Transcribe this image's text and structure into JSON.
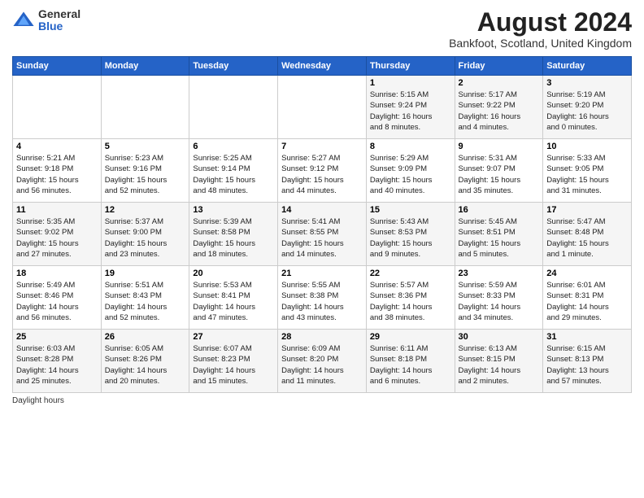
{
  "header": {
    "logo_general": "General",
    "logo_blue": "Blue",
    "title": "August 2024",
    "subtitle": "Bankfoot, Scotland, United Kingdom"
  },
  "weekdays": [
    "Sunday",
    "Monday",
    "Tuesday",
    "Wednesday",
    "Thursday",
    "Friday",
    "Saturday"
  ],
  "weeks": [
    [
      {
        "day": "",
        "detail": ""
      },
      {
        "day": "",
        "detail": ""
      },
      {
        "day": "",
        "detail": ""
      },
      {
        "day": "",
        "detail": ""
      },
      {
        "day": "1",
        "detail": "Sunrise: 5:15 AM\nSunset: 9:24 PM\nDaylight: 16 hours\nand 8 minutes."
      },
      {
        "day": "2",
        "detail": "Sunrise: 5:17 AM\nSunset: 9:22 PM\nDaylight: 16 hours\nand 4 minutes."
      },
      {
        "day": "3",
        "detail": "Sunrise: 5:19 AM\nSunset: 9:20 PM\nDaylight: 16 hours\nand 0 minutes."
      }
    ],
    [
      {
        "day": "4",
        "detail": "Sunrise: 5:21 AM\nSunset: 9:18 PM\nDaylight: 15 hours\nand 56 minutes."
      },
      {
        "day": "5",
        "detail": "Sunrise: 5:23 AM\nSunset: 9:16 PM\nDaylight: 15 hours\nand 52 minutes."
      },
      {
        "day": "6",
        "detail": "Sunrise: 5:25 AM\nSunset: 9:14 PM\nDaylight: 15 hours\nand 48 minutes."
      },
      {
        "day": "7",
        "detail": "Sunrise: 5:27 AM\nSunset: 9:12 PM\nDaylight: 15 hours\nand 44 minutes."
      },
      {
        "day": "8",
        "detail": "Sunrise: 5:29 AM\nSunset: 9:09 PM\nDaylight: 15 hours\nand 40 minutes."
      },
      {
        "day": "9",
        "detail": "Sunrise: 5:31 AM\nSunset: 9:07 PM\nDaylight: 15 hours\nand 35 minutes."
      },
      {
        "day": "10",
        "detail": "Sunrise: 5:33 AM\nSunset: 9:05 PM\nDaylight: 15 hours\nand 31 minutes."
      }
    ],
    [
      {
        "day": "11",
        "detail": "Sunrise: 5:35 AM\nSunset: 9:02 PM\nDaylight: 15 hours\nand 27 minutes."
      },
      {
        "day": "12",
        "detail": "Sunrise: 5:37 AM\nSunset: 9:00 PM\nDaylight: 15 hours\nand 23 minutes."
      },
      {
        "day": "13",
        "detail": "Sunrise: 5:39 AM\nSunset: 8:58 PM\nDaylight: 15 hours\nand 18 minutes."
      },
      {
        "day": "14",
        "detail": "Sunrise: 5:41 AM\nSunset: 8:55 PM\nDaylight: 15 hours\nand 14 minutes."
      },
      {
        "day": "15",
        "detail": "Sunrise: 5:43 AM\nSunset: 8:53 PM\nDaylight: 15 hours\nand 9 minutes."
      },
      {
        "day": "16",
        "detail": "Sunrise: 5:45 AM\nSunset: 8:51 PM\nDaylight: 15 hours\nand 5 minutes."
      },
      {
        "day": "17",
        "detail": "Sunrise: 5:47 AM\nSunset: 8:48 PM\nDaylight: 15 hours\nand 1 minute."
      }
    ],
    [
      {
        "day": "18",
        "detail": "Sunrise: 5:49 AM\nSunset: 8:46 PM\nDaylight: 14 hours\nand 56 minutes."
      },
      {
        "day": "19",
        "detail": "Sunrise: 5:51 AM\nSunset: 8:43 PM\nDaylight: 14 hours\nand 52 minutes."
      },
      {
        "day": "20",
        "detail": "Sunrise: 5:53 AM\nSunset: 8:41 PM\nDaylight: 14 hours\nand 47 minutes."
      },
      {
        "day": "21",
        "detail": "Sunrise: 5:55 AM\nSunset: 8:38 PM\nDaylight: 14 hours\nand 43 minutes."
      },
      {
        "day": "22",
        "detail": "Sunrise: 5:57 AM\nSunset: 8:36 PM\nDaylight: 14 hours\nand 38 minutes."
      },
      {
        "day": "23",
        "detail": "Sunrise: 5:59 AM\nSunset: 8:33 PM\nDaylight: 14 hours\nand 34 minutes."
      },
      {
        "day": "24",
        "detail": "Sunrise: 6:01 AM\nSunset: 8:31 PM\nDaylight: 14 hours\nand 29 minutes."
      }
    ],
    [
      {
        "day": "25",
        "detail": "Sunrise: 6:03 AM\nSunset: 8:28 PM\nDaylight: 14 hours\nand 25 minutes."
      },
      {
        "day": "26",
        "detail": "Sunrise: 6:05 AM\nSunset: 8:26 PM\nDaylight: 14 hours\nand 20 minutes."
      },
      {
        "day": "27",
        "detail": "Sunrise: 6:07 AM\nSunset: 8:23 PM\nDaylight: 14 hours\nand 15 minutes."
      },
      {
        "day": "28",
        "detail": "Sunrise: 6:09 AM\nSunset: 8:20 PM\nDaylight: 14 hours\nand 11 minutes."
      },
      {
        "day": "29",
        "detail": "Sunrise: 6:11 AM\nSunset: 8:18 PM\nDaylight: 14 hours\nand 6 minutes."
      },
      {
        "day": "30",
        "detail": "Sunrise: 6:13 AM\nSunset: 8:15 PM\nDaylight: 14 hours\nand 2 minutes."
      },
      {
        "day": "31",
        "detail": "Sunrise: 6:15 AM\nSunset: 8:13 PM\nDaylight: 13 hours\nand 57 minutes."
      }
    ]
  ],
  "footer": {
    "daylight_label": "Daylight hours"
  }
}
